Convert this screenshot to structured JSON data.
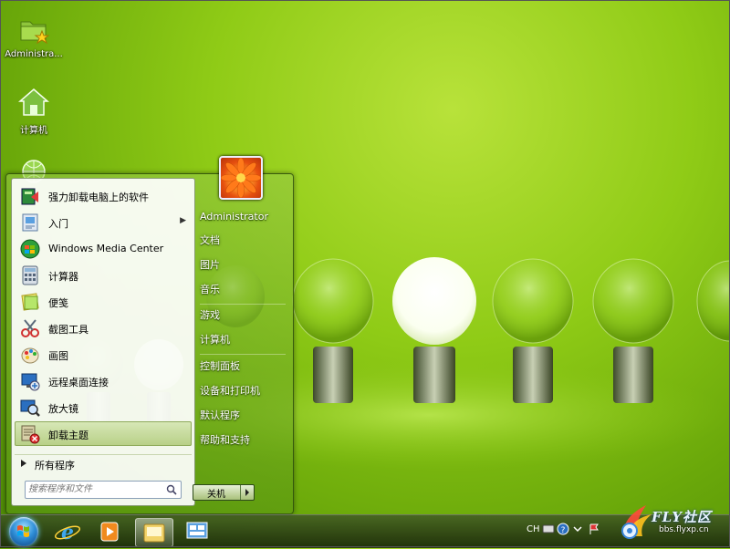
{
  "desktop": {
    "icons": [
      {
        "label": "Administra...",
        "icon": "folder-star-icon"
      },
      {
        "label": "计算机",
        "icon": "computer-icon"
      },
      {
        "label": "",
        "icon": "network-icon"
      }
    ]
  },
  "start_menu": {
    "programs": [
      {
        "label": "强力卸载电脑上的软件",
        "icon": "uninstall-icon",
        "submenu": false
      },
      {
        "label": "入门",
        "icon": "getting-started-icon",
        "submenu": true
      },
      {
        "label": "Windows Media Center",
        "icon": "media-center-icon",
        "submenu": false
      },
      {
        "label": "计算器",
        "icon": "calculator-icon",
        "submenu": false
      },
      {
        "label": "便笺",
        "icon": "sticky-notes-icon",
        "submenu": false
      },
      {
        "label": "截图工具",
        "icon": "snipping-tool-icon",
        "submenu": false
      },
      {
        "label": "画图",
        "icon": "paint-icon",
        "submenu": false
      },
      {
        "label": "远程桌面连接",
        "icon": "remote-desktop-icon",
        "submenu": false
      },
      {
        "label": "放大镜",
        "icon": "magnifier-icon",
        "submenu": false
      },
      {
        "label": "卸载主题",
        "icon": "uninstall-theme-icon",
        "submenu": false,
        "selected": true
      }
    ],
    "all_programs": "所有程序",
    "search_placeholder": "搜索程序和文件",
    "right_items": [
      "Administrator",
      "文档",
      "图片",
      "音乐",
      "游戏",
      "计算机",
      "控制面板",
      "设备和打印机",
      "默认程序",
      "帮助和支持"
    ],
    "shutdown_label": "关机"
  },
  "taskbar": {
    "buttons": [
      "start-orb-icon",
      "internet-explorer-icon",
      "media-player-icon",
      "file-explorer-icon",
      "remote-desktop-icon"
    ],
    "active_index": 3,
    "tray": {
      "language": "CH"
    }
  },
  "watermark": {
    "brand": "FLY社区",
    "url": "bbs.flyxp.cn"
  },
  "colors": {
    "accent": "#8fcb16",
    "selected": "#b7cf86"
  }
}
